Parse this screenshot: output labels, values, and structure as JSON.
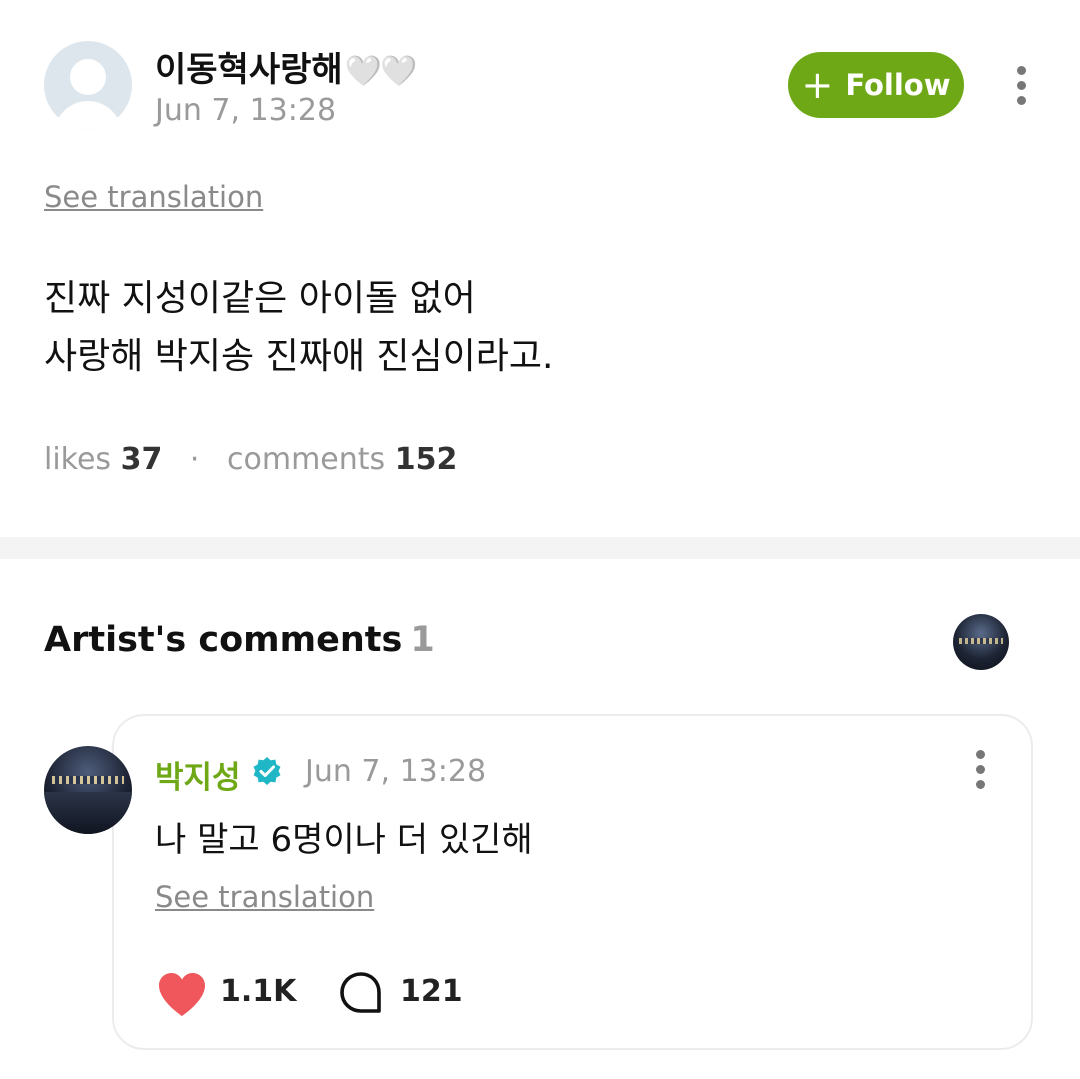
{
  "post": {
    "author": "이동혁사랑해",
    "author_hearts": "🤍🤍",
    "timestamp": "Jun 7, 13:28",
    "follow_label": "Follow",
    "see_translation": "See translation",
    "body_lines": [
      "진짜 지성이같은 아이돌 없어",
      "사랑해 박지송 진짜애 진심이라고."
    ],
    "likes_label": "likes",
    "likes_count": "37",
    "comments_label": "comments",
    "comments_count": "152",
    "separator": "·"
  },
  "artist_comments": {
    "title": "Artist's comments",
    "count": "1",
    "items": [
      {
        "name": "박지성",
        "timestamp": "Jun 7, 13:28",
        "text": "나 말고 6명이나 더 있긴해",
        "see_translation": "See translation",
        "likes": "1.1K",
        "replies": "121"
      }
    ]
  },
  "colors": {
    "accent_green": "#6fa816",
    "like_red": "#f0575c",
    "verified_teal": "#1fb7c6"
  },
  "icons": [
    "more-vertical-icon",
    "plus-icon",
    "verified-badge-icon",
    "heart-icon",
    "comment-bubble-icon"
  ]
}
